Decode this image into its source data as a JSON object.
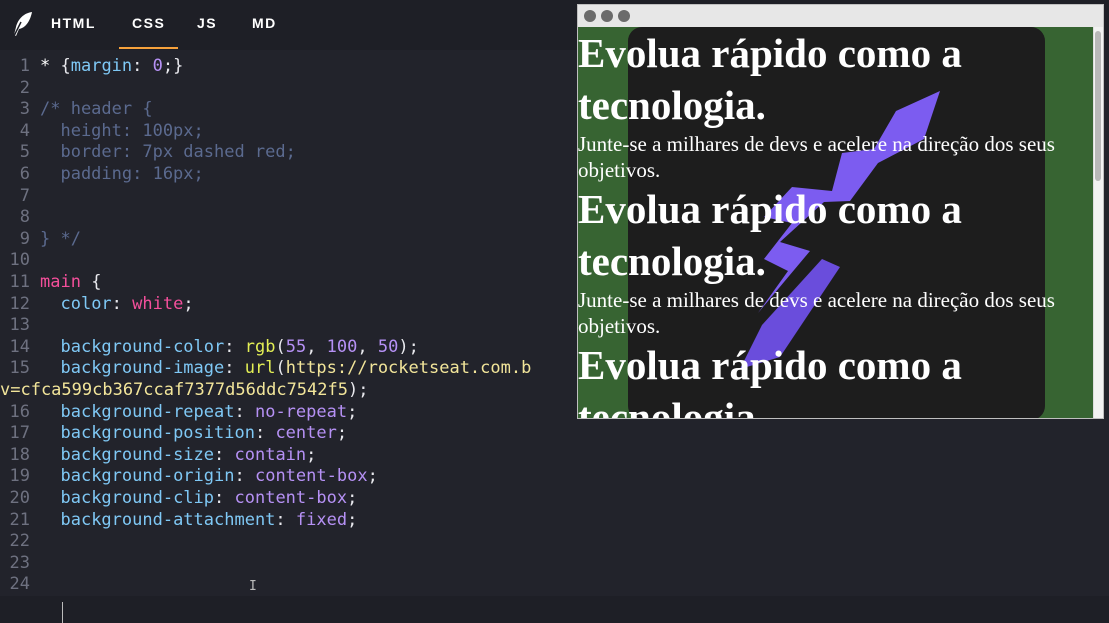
{
  "tabs": [
    {
      "label": "HTML",
      "active": false
    },
    {
      "label": "CSS",
      "active": true
    },
    {
      "label": "JS",
      "active": false
    },
    {
      "label": "MD",
      "active": false
    }
  ],
  "colors": {
    "accent": "#f6a13b",
    "editor_bg": "#22232b",
    "preview_green": "#376432",
    "rocket": "#7c5cf0"
  },
  "icons": [
    "feather-logo-icon",
    "text-cursor-icon"
  ],
  "code_lines": [
    {
      "n": "1",
      "segs": [
        [
          "sel",
          "* "
        ],
        [
          "",
          ""
        ],
        [
          "",
          "{"
        ],
        [
          "prop",
          "margin"
        ],
        [
          "",
          ": "
        ],
        [
          "val",
          "0"
        ],
        [
          "",
          ";}"
        ]
      ]
    },
    {
      "n": "2",
      "segs": []
    },
    {
      "n": "3",
      "segs": [
        [
          "cm",
          "/* header {"
        ]
      ]
    },
    {
      "n": "4",
      "segs": [
        [
          "cm",
          "  height: 100px;"
        ]
      ]
    },
    {
      "n": "5",
      "segs": [
        [
          "cm",
          "  border: 7px dashed red;"
        ]
      ]
    },
    {
      "n": "6",
      "segs": [
        [
          "cm",
          "  padding: 16px;"
        ]
      ]
    },
    {
      "n": "7",
      "segs": []
    },
    {
      "n": "8",
      "segs": []
    },
    {
      "n": "9",
      "segs": [
        [
          "cm",
          "} */"
        ]
      ]
    },
    {
      "n": "10",
      "segs": []
    },
    {
      "n": "11",
      "segs": [
        [
          "kw",
          "main"
        ],
        [
          "",
          " {"
        ]
      ]
    },
    {
      "n": "12",
      "segs": [
        [
          "",
          "  "
        ],
        [
          "prop",
          "color"
        ],
        [
          "",
          ": "
        ],
        [
          "kw",
          "white"
        ],
        [
          "",
          ";"
        ]
      ]
    },
    {
      "n": "13",
      "segs": []
    },
    {
      "n": "14",
      "segs": [
        [
          "",
          "  "
        ],
        [
          "prop",
          "background-color"
        ],
        [
          "",
          ": "
        ],
        [
          "fn",
          "rgb"
        ],
        [
          "",
          "("
        ],
        [
          "val",
          "55"
        ],
        [
          "",
          ", "
        ],
        [
          "val",
          "100"
        ],
        [
          "",
          ", "
        ],
        [
          "val",
          "50"
        ],
        [
          "",
          ");"
        ]
      ]
    },
    {
      "n": "15",
      "segs": [
        [
          "",
          "  "
        ],
        [
          "prop",
          "background-image"
        ],
        [
          "",
          ": "
        ],
        [
          "fn",
          "url"
        ],
        [
          "",
          "("
        ],
        [
          "str",
          "https://rocketseat.com.b"
        ]
      ]
    },
    {
      "n": "",
      "segs": [
        [
          "str",
          "v=cfca599cb367ccaf7377d56ddc7542f5"
        ],
        [
          "",
          ");"
        ]
      ]
    },
    {
      "n": "16",
      "segs": [
        [
          "",
          "  "
        ],
        [
          "prop",
          "background-repeat"
        ],
        [
          "",
          ": "
        ],
        [
          "val",
          "no-repeat"
        ],
        [
          "",
          ";"
        ]
      ]
    },
    {
      "n": "17",
      "segs": [
        [
          "",
          "  "
        ],
        [
          "prop",
          "background-position"
        ],
        [
          "",
          ": "
        ],
        [
          "val",
          "center"
        ],
        [
          "",
          ";"
        ]
      ]
    },
    {
      "n": "18",
      "segs": [
        [
          "",
          "  "
        ],
        [
          "prop",
          "background-size"
        ],
        [
          "",
          ": "
        ],
        [
          "val",
          "contain"
        ],
        [
          "",
          ";"
        ]
      ]
    },
    {
      "n": "19",
      "segs": [
        [
          "",
          "  "
        ],
        [
          "prop",
          "background-origin"
        ],
        [
          "",
          ": "
        ],
        [
          "val",
          "content-box"
        ],
        [
          "",
          ";"
        ]
      ]
    },
    {
      "n": "20",
      "segs": [
        [
          "",
          "  "
        ],
        [
          "prop",
          "background-clip"
        ],
        [
          "",
          ": "
        ],
        [
          "val",
          "content-box"
        ],
        [
          "",
          ";"
        ]
      ]
    },
    {
      "n": "21",
      "segs": [
        [
          "",
          "  "
        ],
        [
          "prop",
          "background-attachment"
        ],
        [
          "",
          ": "
        ],
        [
          "val",
          "fixed"
        ],
        [
          "",
          ";"
        ]
      ]
    },
    {
      "n": "22",
      "segs": []
    },
    {
      "n": "23",
      "segs": []
    },
    {
      "n": "24",
      "segs": []
    }
  ],
  "preview": {
    "blocks": [
      {
        "heading": "Evolua rápido como a tecnologia.",
        "text": "Junte-se a milhares de devs e acelere na direção dos seus objetivos."
      },
      {
        "heading": "Evolua rápido como a tecnologia.",
        "text": "Junte-se a milhares de devs e acelere na direção dos seus objetivos."
      },
      {
        "heading": "Evolua rápido como a tecnologia.",
        "text": ""
      }
    ]
  }
}
